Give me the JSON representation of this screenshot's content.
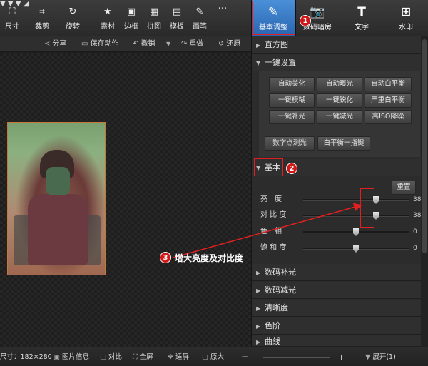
{
  "toolbar": {
    "tools": [
      {
        "label": "尺寸",
        "icon": "crop-frame-icon"
      },
      {
        "label": "裁剪",
        "icon": "crop-icon"
      },
      {
        "label": "旋转",
        "icon": "rotate-icon"
      },
      {
        "label": "素材",
        "icon": "star-icon"
      },
      {
        "label": "边框",
        "icon": "frame-icon"
      },
      {
        "label": "拼图",
        "icon": "grid-icon"
      },
      {
        "label": "模板",
        "icon": "template-icon"
      },
      {
        "label": "画笔",
        "icon": "brush-icon"
      },
      {
        "label": "···",
        "icon": "more-icon"
      }
    ]
  },
  "tabs": [
    {
      "label": "基本调整",
      "active": true
    },
    {
      "label": "数码暗房",
      "active": false
    },
    {
      "label": "文字",
      "active": false
    },
    {
      "label": "水印",
      "active": false
    }
  ],
  "subbar": {
    "share": "分享",
    "save_action": "保存动作",
    "undo": "撤销",
    "redo": "重做",
    "restore": "还原"
  },
  "panel": {
    "histogram": "直方图",
    "one_click": "一键设置",
    "buttons": [
      "自动美化",
      "自动曝光",
      "自动白平衡",
      "一键模糊",
      "一键锐化",
      "严重白平衡",
      "一键补光",
      "一键减光",
      "高ISO降噪",
      "数字点测光",
      "白平衡一指键"
    ],
    "basic": "基本",
    "reset": "重置",
    "sliders": [
      {
        "label": "亮　度",
        "value": "38",
        "fraction": 0.69
      },
      {
        "label": "对 比 度",
        "value": "38",
        "fraction": 0.69
      },
      {
        "label": "色　相",
        "value": "0",
        "fraction": 0.5
      },
      {
        "label": "饱 和 度",
        "value": "0",
        "fraction": 0.5
      }
    ],
    "sections": [
      "数码补光",
      "数码减光",
      "清晰度",
      "色阶",
      "曲线"
    ]
  },
  "annotations": {
    "badge1": "1",
    "badge2": "2",
    "badge3": "3",
    "callout": "增大亮度及对比度"
  },
  "status": {
    "size": "尺寸：182×280",
    "info": "图片信息",
    "compare": "对比",
    "fullscreen": "全屏",
    "fit": "适屏",
    "original": "原大",
    "minus": "−",
    "plus": "+",
    "expand": "展开(1)"
  },
  "colors": {
    "accent": "#2a64b0",
    "annotation": "#e02020"
  }
}
